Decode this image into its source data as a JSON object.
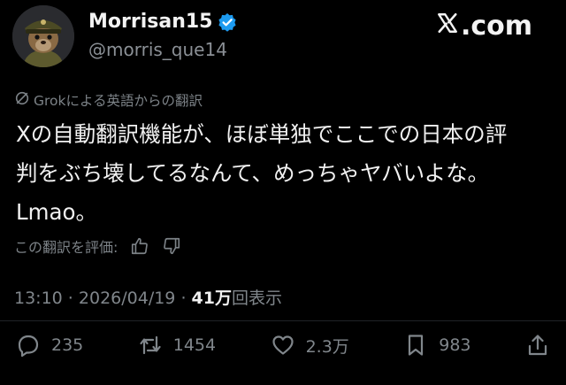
{
  "author": {
    "display_name": "Morrisan15",
    "handle": "@morris_que14",
    "verified": true,
    "avatar": "uniformed-groundhog-avatar"
  },
  "brand": {
    "label": ".com",
    "logo": "x-logo-icon"
  },
  "translation_note": "Grokによる英語からの翻訳",
  "tweet": {
    "lines": [
      "Xの自動翻訳機能が、ほぼ単独でここでの日本の評",
      "判をぶち壊してるなんて、めっちゃヤバいよな。",
      "Lmao。"
    ]
  },
  "rating": {
    "label": "この翻訳を評価:",
    "up_icon": "thumbs-up-icon",
    "down_icon": "thumbs-down-icon"
  },
  "meta": {
    "time": "13:10",
    "separator1": " · ",
    "date": "2026/04/19",
    "separator2": " · ",
    "views_count": "41万",
    "views_label": "回表示"
  },
  "actions": {
    "reply_count": "235",
    "repost_count": "1454",
    "like_count": "2.3万",
    "bookmark_count": "983"
  },
  "colors": {
    "background": "#000000",
    "text": "#e7e9ea",
    "secondary": "#80868b",
    "verified": "#1d9bf0"
  }
}
